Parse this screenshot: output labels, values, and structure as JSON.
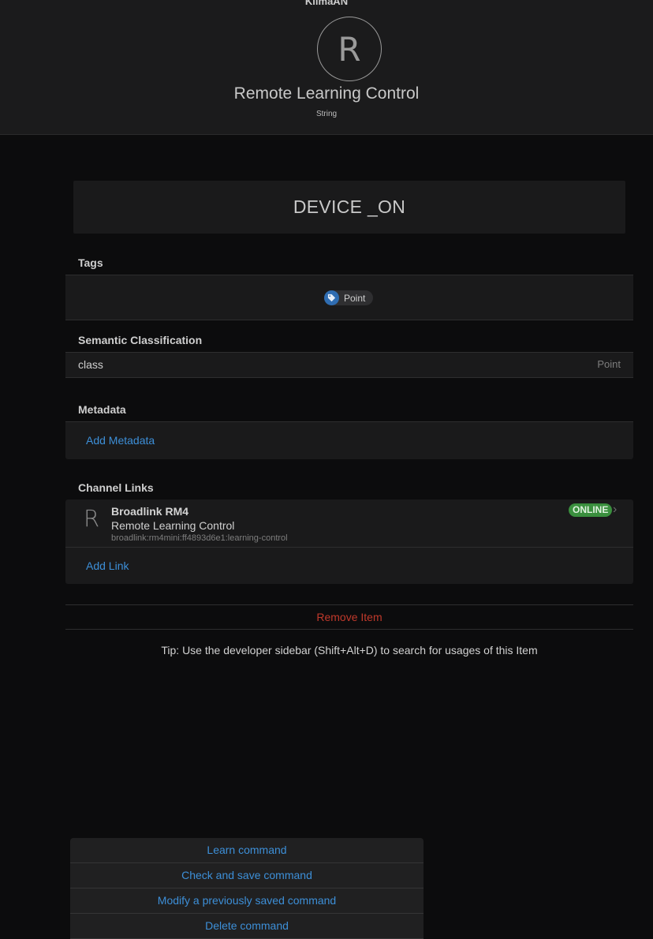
{
  "header": {
    "top_label": "KlimaAN",
    "avatar_letter": "R",
    "title": "Remote Learning Control",
    "type": "String"
  },
  "state": "DEVICE _ON",
  "tags": {
    "title": "Tags",
    "items": [
      {
        "label": "Point",
        "icon": "tag-icon"
      }
    ]
  },
  "semantic": {
    "title": "Semantic Classification",
    "key": "class",
    "value": "Point"
  },
  "metadata": {
    "title": "Metadata",
    "add_label": "Add Metadata"
  },
  "channel_links": {
    "title": "Channel Links",
    "links": [
      {
        "letter": "R",
        "thing": "Broadlink RM4",
        "channel": "Remote Learning Control",
        "uid": "broadlink:rm4mini:ff4893d6e1:learning-control",
        "status": "ONLINE"
      }
    ],
    "add_label": "Add Link"
  },
  "remove_label": "Remove Item",
  "tip": "Tip: Use the developer sidebar (Shift+Alt+D) to search for usages of this Item",
  "action_menu": {
    "items": [
      "Learn command",
      "Check and save command",
      "Modify a previously saved command",
      "Delete command"
    ]
  },
  "colors": {
    "accent": "#3d8fd8",
    "online": "#3a8f3e",
    "danger": "#c0392b",
    "tag": "#2f6db2"
  }
}
